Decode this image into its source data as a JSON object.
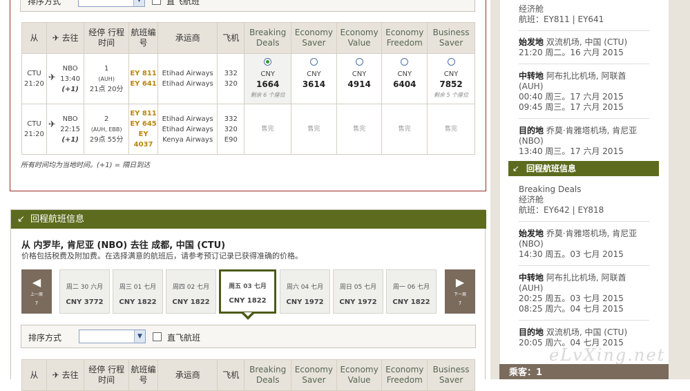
{
  "top_sort": {
    "label": "排序方式",
    "direct_label": "直飞航班"
  },
  "outbound": {
    "headers": {
      "from": "从",
      "to": "去往",
      "stops": "经停 行程时间",
      "flightno": "航班编号",
      "carrier": "承运商",
      "aircraft": "飞机",
      "fares": [
        "Breaking Deals",
        "Economy Saver",
        "Economy Value",
        "Economy Freedom",
        "Business Saver"
      ]
    },
    "rows": [
      {
        "from_code": "CTU",
        "from_time": "21:20",
        "to_code": "NBO",
        "to_time": "13:40",
        "to_plus": "(+1)",
        "stops": "1",
        "stops_via": "(AUH)",
        "duration": "21点 20分",
        "flights": [
          "EY 811",
          "EY 641"
        ],
        "carriers": [
          "Etihad Airways",
          "Etihad Airways"
        ],
        "aircraft": [
          "332",
          "320"
        ],
        "fares": [
          {
            "cur": "CNY",
            "price": "1664",
            "seats": "剩余 6 个座位",
            "selected": true
          },
          {
            "cur": "CNY",
            "price": "3614",
            "seats": "",
            "selected": false
          },
          {
            "cur": "CNY",
            "price": "4914",
            "seats": "",
            "selected": false
          },
          {
            "cur": "CNY",
            "price": "6404",
            "seats": "",
            "selected": false
          },
          {
            "cur": "CNY",
            "price": "7852",
            "seats": "剩余 5 个座位",
            "selected": false
          }
        ]
      },
      {
        "from_code": "CTU",
        "from_time": "21:20",
        "to_code": "NBO",
        "to_time": "22:15",
        "to_plus": "(+1)",
        "stops": "2",
        "stops_via": "(AUH, EBB)",
        "duration": "29点 55分",
        "flights": [
          "EY 811",
          "EY 645",
          "EY",
          "4037"
        ],
        "carriers": [
          "Etihad Airways",
          "Etihad Airways",
          "Kenya Airways"
        ],
        "aircraft": [
          "332",
          "320",
          "E90"
        ],
        "soldout": "售完"
      }
    ],
    "note": "所有时间均为当地时间。(+1) = 隔日到达"
  },
  "return": {
    "header": "回程航班信息",
    "title": "从 内罗毕, 肯尼亚 (NBO) 去往 成都, 中国 (CTU)",
    "subtitle": "价格包括税费及附加费。在选择满意的航班后，请参考预订记录已获得准确的价格。",
    "prev": {
      "label": "上一周",
      "num": "7"
    },
    "next": {
      "label": "下一周",
      "num": "7"
    },
    "days": [
      {
        "date": "周二 30 六月",
        "price": "CNY 3772"
      },
      {
        "date": "周三 01 七月",
        "price": "CNY 1822"
      },
      {
        "date": "周四 02 七月",
        "price": "CNY 1822"
      },
      {
        "date": "周五 03 七月",
        "price": "CNY 1822"
      },
      {
        "date": "周六 04 七月",
        "price": "CNY 1972"
      },
      {
        "date": "周日 05 七月",
        "price": "CNY 1972"
      },
      {
        "date": "周一 06 七月",
        "price": "CNY 1822"
      }
    ],
    "selected_index": 3,
    "sort": {
      "label": "排序方式",
      "direct_label": "直飞航班"
    },
    "headers": {
      "from": "从",
      "to": "去往",
      "stops": "经停 行程时间",
      "flightno": "航班编号",
      "carrier": "承运商",
      "aircraft": "飞机",
      "fares": [
        "Breaking Deals",
        "Economy Saver",
        "Economy Value",
        "Economy Freedom",
        "Business Saver"
      ]
    }
  },
  "sidebar": {
    "out_cabin": "经济舱",
    "out_flights": "航班：EY811 | EY641",
    "out_origin_label": "始发地",
    "out_origin": "双流机场, 中国 (CTU)",
    "out_origin_time": "21:20 周二。16 六月 2015",
    "out_transit_label": "中转地",
    "out_transit": "阿布扎比机场, 阿联酋 (AUH)",
    "out_transit_t1": "00:40 周三。17 六月 2015",
    "out_transit_t2": "09:45 周三。17 六月 2015",
    "out_dest_label": "目的地",
    "out_dest": "乔莫·肯雅塔机场, 肯尼亚 (NBO)",
    "out_dest_time": "13:40 周三。17 六月 2015",
    "ret_header": "回程航班信息",
    "ret_fare": "Breaking Deals",
    "ret_cabin": "经济舱",
    "ret_flights": "航班：EY642 | EY818",
    "ret_origin_label": "始发地",
    "ret_origin": "乔莫·肯雅塔机场, 肯尼亚 (NBO)",
    "ret_origin_time": "14:30 周五。03 七月 2015",
    "ret_transit_label": "中转地",
    "ret_transit": "阿布扎比机场, 阿联酋 (AUH)",
    "ret_transit_t1": "20:25 周五。03 七月 2015",
    "ret_transit_t2": "08:25 周六。04 七月 2015",
    "ret_dest_label": "目的地",
    "ret_dest": "双流机场, 中国 (CTU)",
    "ret_dest_time": "20:05 周六。04 七月 2015",
    "guest": "乘客：1"
  },
  "watermark": "eLvXing.net"
}
